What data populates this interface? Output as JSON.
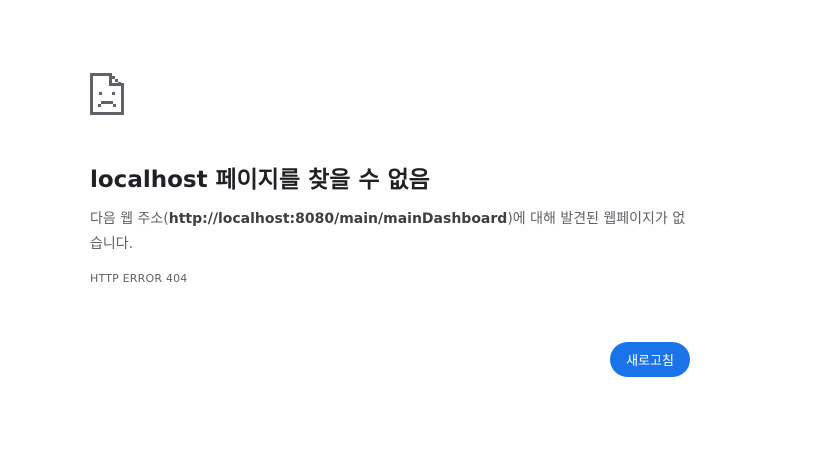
{
  "icon": {
    "name": "sad-page-icon",
    "color": "#5f6368"
  },
  "error": {
    "title": "localhost 페이지를 찾을 수 없음",
    "message_prefix": "다음 웹 주소(",
    "url": "http://localhost:8080/main/mainDashboard",
    "message_suffix": ")에 대해 발견된 웹페이지가 없습니다.",
    "code": "HTTP ERROR 404"
  },
  "actions": {
    "reload_label": "새로고침"
  },
  "colors": {
    "accent": "#1a73e8",
    "title_text": "#202124",
    "body_text": "#5f6368"
  }
}
